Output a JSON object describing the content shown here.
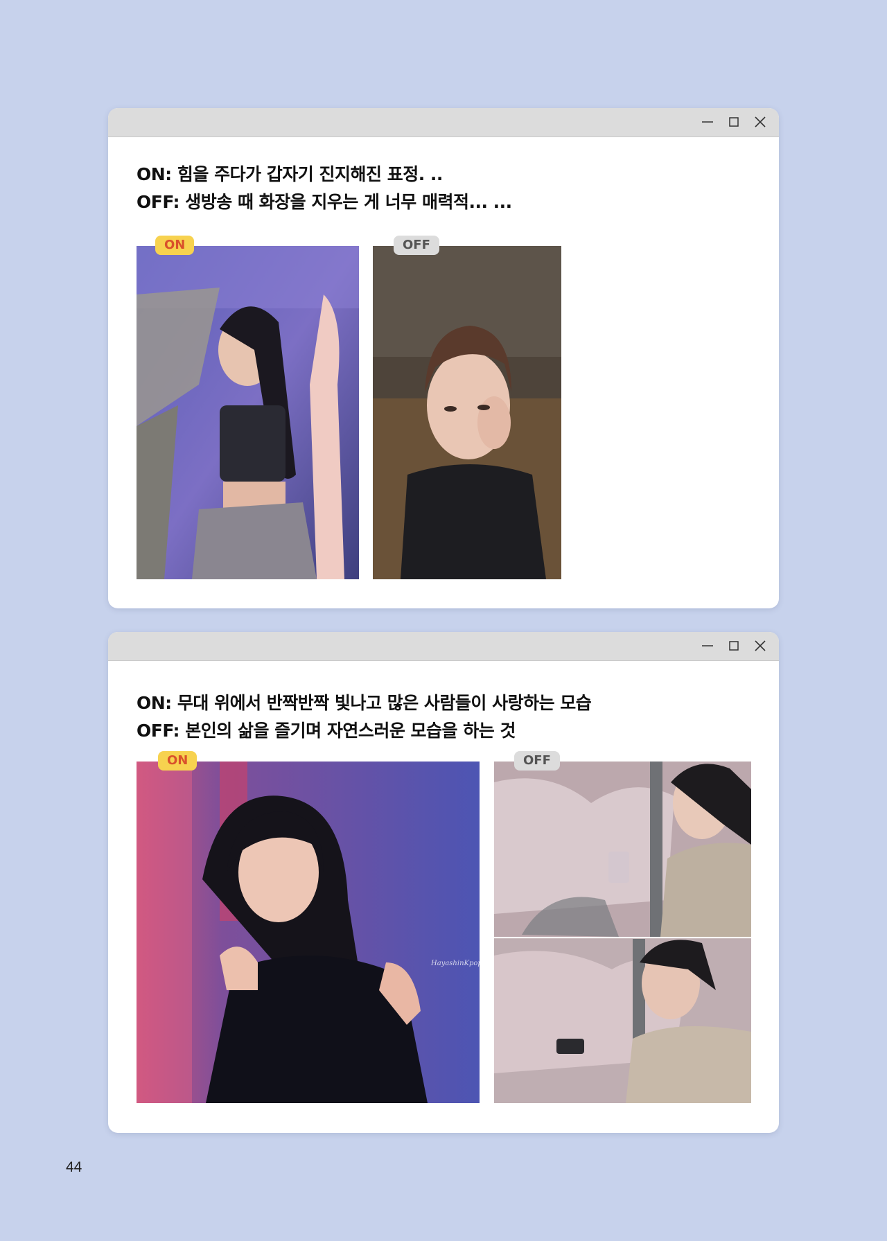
{
  "windows": [
    {
      "caption_lines": [
        "ON: 힘을 주다가 갑자기 진지해진 표정. ..",
        "OFF: 생방송 때 화장을 지우는 게 너무 매력적... ..."
      ],
      "on_tag": "ON",
      "off_tag": "OFF"
    },
    {
      "caption_lines": [
        "ON: 무대 위에서 반짝반짝 빛나고 많은 사람들이 사랑하는 모습",
        "OFF: 본인의 삶을 즐기며 자연스러운 모습을 하는 것"
      ],
      "on_tag": "ON",
      "off_tag": "OFF",
      "watermark": "HayashinKpop"
    }
  ],
  "page_number": "44",
  "icons": [
    "minimize-icon",
    "maximize-icon",
    "close-icon"
  ],
  "colors": {
    "background": "#c7d2ec",
    "titlebar": "#dcdcdc",
    "on_tag_bg": "#f7d24f",
    "on_tag_text": "#d9512b",
    "off_tag_bg": "#dcdcdc",
    "off_tag_text": "#555555"
  }
}
